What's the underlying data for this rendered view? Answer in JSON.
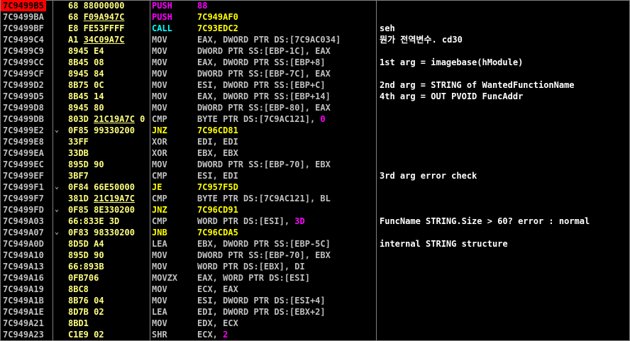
{
  "rows": [
    {
      "addr": "7C9499B5",
      "sel": true,
      "hex": "68",
      "hex_u": "",
      "hex_rest": " 88000000",
      "mn": "PUSH",
      "mc": "push",
      "op": "",
      "lit": "88",
      "op2": "",
      "comment": ""
    },
    {
      "addr": "7C9499BA",
      "hex": "68",
      "hex_u": "F09A947C",
      "hex_rest": "",
      "mn": "PUSH",
      "mc": "push",
      "op": "",
      "lit": "",
      "op2": "",
      "opy": "7C949AF0",
      "comment": ""
    },
    {
      "addr": "7C9499BF",
      "hex": "E8",
      "hex_u": "",
      "hex_rest": " FE53FFFF",
      "mn": "CALL",
      "mc": "call",
      "op": "",
      "opy": "7C93EDC2",
      "comment": "seh"
    },
    {
      "addr": "7C9499C4",
      "hex": "A1",
      "hex_u": "34C09A7C",
      "hex_rest": "",
      "mn": "MOV",
      "mc": "pl",
      "op": "EAX, DWORD PTR DS:[7C9AC034]",
      "comment": "뭔가 전역변수. cd30"
    },
    {
      "addr": "7C9499C9",
      "hex": "8945 E4",
      "hex_u": "",
      "hex_rest": "",
      "mn": "MOV",
      "mc": "pl",
      "op": "DWORD PTR SS:[EBP-1C], EAX",
      "comment": ""
    },
    {
      "addr": "7C9499CC",
      "hex": "8B45 08",
      "hex_u": "",
      "hex_rest": "",
      "mn": "MOV",
      "mc": "pl",
      "op": "EAX, DWORD PTR SS:[EBP+8]",
      "comment": "1st arg = imagebase(hModule)"
    },
    {
      "addr": "7C9499CF",
      "hex": "8945 84",
      "hex_u": "",
      "hex_rest": "",
      "mn": "MOV",
      "mc": "pl",
      "op": "DWORD PTR SS:[EBP-7C], EAX",
      "comment": ""
    },
    {
      "addr": "7C9499D2",
      "hex": "8B75 0C",
      "hex_u": "",
      "hex_rest": "",
      "mn": "MOV",
      "mc": "pl",
      "op": "ESI, DWORD PTR SS:[EBP+C]",
      "comment": "2nd arg = STRING of WantedFunctionName"
    },
    {
      "addr": "7C9499D5",
      "hex": "8B45 14",
      "hex_u": "",
      "hex_rest": "",
      "mn": "MOV",
      "mc": "pl",
      "op": "EAX, DWORD PTR SS:[EBP+14]",
      "comment": "4th arg = OUT PVOID FuncAddr"
    },
    {
      "addr": "7C9499D8",
      "hex": "8945 80",
      "hex_u": "",
      "hex_rest": "",
      "mn": "MOV",
      "mc": "pl",
      "op": "DWORD PTR SS:[EBP-80], EAX",
      "comment": ""
    },
    {
      "addr": "7C9499DB",
      "hex": "803D",
      "hex_u": "21C19A7C",
      "hex_rest": " 0",
      "mn": "CMP",
      "mc": "pl",
      "op": "BYTE PTR DS:[7C9AC121], ",
      "lit": "0",
      "comment": ""
    },
    {
      "addr": "7C9499E2",
      "jm": true,
      "hex": "0F85 99330200",
      "hex_u": "",
      "hex_rest": "",
      "mn": "JNZ",
      "mc": "jmp",
      "op": "",
      "opy": "7C96CD81",
      "comment": ""
    },
    {
      "addr": "7C9499E8",
      "hex": "33FF",
      "hex_u": "",
      "hex_rest": "",
      "mn": "XOR",
      "mc": "pl",
      "op": "EDI, EDI",
      "comment": ""
    },
    {
      "addr": "7C9499EA",
      "hex": "33DB",
      "hex_u": "",
      "hex_rest": "",
      "mn": "XOR",
      "mc": "pl",
      "op": "EBX, EBX",
      "comment": ""
    },
    {
      "addr": "7C9499EC",
      "hex": "895D 90",
      "hex_u": "",
      "hex_rest": "",
      "mn": "MOV",
      "mc": "pl",
      "op": "DWORD PTR SS:[EBP-70], EBX",
      "comment": ""
    },
    {
      "addr": "7C9499EF",
      "hex": "3BF7",
      "hex_u": "",
      "hex_rest": "",
      "mn": "CMP",
      "mc": "pl",
      "op": "ESI, EDI",
      "comment": "3rd arg error check"
    },
    {
      "addr": "7C9499F1",
      "jm": true,
      "hex": "0F84 66E50000",
      "hex_u": "",
      "hex_rest": "",
      "mn": "JE",
      "mc": "jmp",
      "op": "",
      "opy": "7C957F5D",
      "comment": ""
    },
    {
      "addr": "7C9499F7",
      "hex": "381D",
      "hex_u": "21C19A7C",
      "hex_rest": "",
      "mn": "CMP",
      "mc": "pl",
      "op": "BYTE PTR DS:[7C9AC121], BL",
      "comment": ""
    },
    {
      "addr": "7C9499FD",
      "jm": true,
      "hex": "0F85 8E330200",
      "hex_u": "",
      "hex_rest": "",
      "mn": "JNZ",
      "mc": "jmp",
      "op": "",
      "opy": "7C96CD91",
      "comment": ""
    },
    {
      "addr": "7C949A03",
      "hex": "66:833E 3D",
      "hex_u": "",
      "hex_rest": "",
      "mn": "CMP",
      "mc": "pl",
      "op": "WORD PTR DS:[ESI], ",
      "lit": "3D",
      "comment": "FuncName STRING.Size > 60? error : normal"
    },
    {
      "addr": "7C949A07",
      "jm": true,
      "hex": "0F83 98330200",
      "hex_u": "",
      "hex_rest": "",
      "mn": "JNB",
      "mc": "jmp",
      "op": "",
      "opy": "7C96CDA5",
      "comment": ""
    },
    {
      "addr": "7C949A0D",
      "hex": "8D5D A4",
      "hex_u": "",
      "hex_rest": "",
      "mn": "LEA",
      "mc": "pl",
      "op": "EBX, DWORD PTR SS:[EBP-5C]",
      "comment": "internal STRING structure"
    },
    {
      "addr": "7C949A10",
      "hex": "895D 90",
      "hex_u": "",
      "hex_rest": "",
      "mn": "MOV",
      "mc": "pl",
      "op": "DWORD PTR SS:[EBP-70], EBX",
      "comment": ""
    },
    {
      "addr": "7C949A13",
      "hex": "66:893B",
      "hex_u": "",
      "hex_rest": "",
      "mn": "MOV",
      "mc": "pl",
      "op": "WORD PTR DS:[EBX], DI",
      "comment": ""
    },
    {
      "addr": "7C949A16",
      "hex": "0FB706",
      "hex_u": "",
      "hex_rest": "",
      "mn": "MOVZX",
      "mc": "pl",
      "op": "EAX, WORD PTR DS:[ESI]",
      "comment": ""
    },
    {
      "addr": "7C949A19",
      "hex": "8BC8",
      "hex_u": "",
      "hex_rest": "",
      "mn": "MOV",
      "mc": "pl",
      "op": "ECX, EAX",
      "comment": ""
    },
    {
      "addr": "7C949A1B",
      "hex": "8B76 04",
      "hex_u": "",
      "hex_rest": "",
      "mn": "MOV",
      "mc": "pl",
      "op": "ESI, DWORD PTR DS:[ESI+4]",
      "comment": ""
    },
    {
      "addr": "7C949A1E",
      "hex": "8D7B 02",
      "hex_u": "",
      "hex_rest": "",
      "mn": "LEA",
      "mc": "pl",
      "op": "EDI, DWORD PTR DS:[EBX+2]",
      "comment": ""
    },
    {
      "addr": "7C949A21",
      "hex": "8BD1",
      "hex_u": "",
      "hex_rest": "",
      "mn": "MOV",
      "mc": "pl",
      "op": "EDX, ECX",
      "comment": ""
    },
    {
      "addr": "7C949A23",
      "hex": "C1E9 02",
      "hex_u": "",
      "hex_rest": "",
      "mn": "SHR",
      "mc": "pl",
      "op": "ECX, ",
      "lit": "2",
      "comment": ""
    }
  ],
  "jump_marker": "⌄"
}
